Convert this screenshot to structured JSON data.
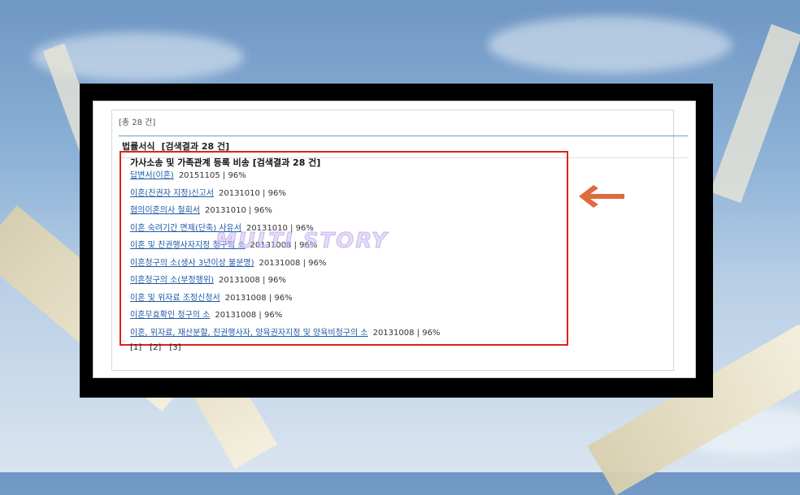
{
  "panel": {
    "total_count": "[총 28 건]",
    "section_title": "법률서식",
    "section_meta": "[검색결과 28 건]"
  },
  "results": {
    "group_title": "가사소송 및 가족관계 등록 비송 [검색결과 28 건]",
    "items": [
      {
        "title": "답변서(이혼)",
        "info": "20151105 | 96%"
      },
      {
        "title": "이혼(친권자 지정)신고서",
        "info": "20131010 | 96%"
      },
      {
        "title": "협의이혼의사 철회서",
        "info": "20131010 | 96%"
      },
      {
        "title": "이혼 숙려기간 면제(단축) 사유서",
        "info": "20131010 | 96%"
      },
      {
        "title": "이혼 및 친권행사자지정 청구의 소",
        "info": "20131008 | 96%"
      },
      {
        "title": "이혼청구의 소(생사 3년이상 불분명)",
        "info": "20131008 | 96%"
      },
      {
        "title": "이혼청구의 소(부정행위)",
        "info": "20131008 | 96%"
      },
      {
        "title": "이혼 및 위자료 조정신청서",
        "info": "20131008 | 96%"
      },
      {
        "title": "이혼무효확인 청구의 소",
        "info": "20131008 | 96%"
      },
      {
        "title": "이혼, 위자료, 재산분할, 친권행사자, 양육권자지정 및 양육비청구의 소",
        "info": "20131008 | 96%"
      }
    ]
  },
  "pager": [
    "[1]",
    "[2]",
    "[3]"
  ],
  "watermark": "MULTI STORY",
  "colors": {
    "highlight_box": "#e02020",
    "arrow": "#e06a3c",
    "link": "#1e5aa8"
  },
  "icons": {
    "arrow": "left-arrow-icon"
  }
}
